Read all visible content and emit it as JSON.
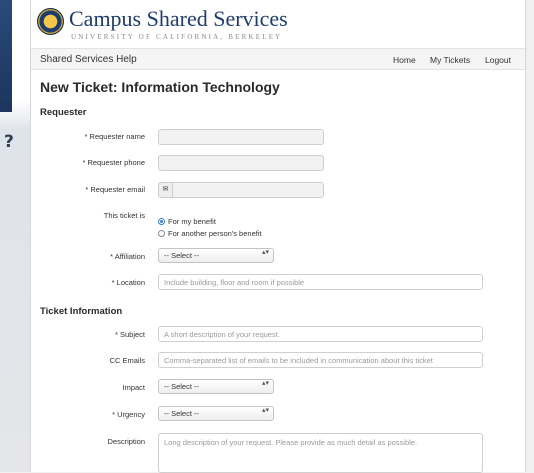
{
  "brand": {
    "title": "Campus Shared Services",
    "subtitle": "UNIVERSITY OF CALIFORNIA, BERKELEY"
  },
  "navbar": {
    "app_name": "Shared Services Help",
    "links": [
      "Home",
      "My Tickets",
      "Logout"
    ]
  },
  "page": {
    "title": "New Ticket: Information Technology"
  },
  "background": {
    "question_glyph": "?"
  },
  "requester": {
    "heading": "Requester",
    "name_label": "* Requester name",
    "phone_label": "* Requester phone",
    "email_label": "* Requester email",
    "email_icon": "✉",
    "ticket_is_label": "This ticket is",
    "ticket_is_options": [
      "For my benefit",
      "For another person's benefit"
    ],
    "ticket_is_selected": "For my benefit",
    "affiliation_label": "* Affiliation",
    "affiliation_value": "-- Select --",
    "location_label": "* Location",
    "location_placeholder": "Include building, floor and room if possible"
  },
  "ticket_info": {
    "heading": "Ticket Information",
    "subject_label": "* Subject",
    "subject_placeholder": "A short description of your request.",
    "cc_label": "CC Emails",
    "cc_placeholder": "Comma-separated list of emails to be included in communication about this ticket",
    "impact_label": "Impact",
    "impact_value": "-- Select --",
    "urgency_label": "* Urgency",
    "urgency_value": "-- Select --",
    "description_label": "Description",
    "description_placeholder": "Long description of your request.  Please provide as much detail as possible."
  },
  "select_arrows": "▴▾",
  "colors": {
    "brand": "#1e3c6d",
    "accent": "#3b7dd8",
    "navbar_bg": "#f5f5f5"
  }
}
